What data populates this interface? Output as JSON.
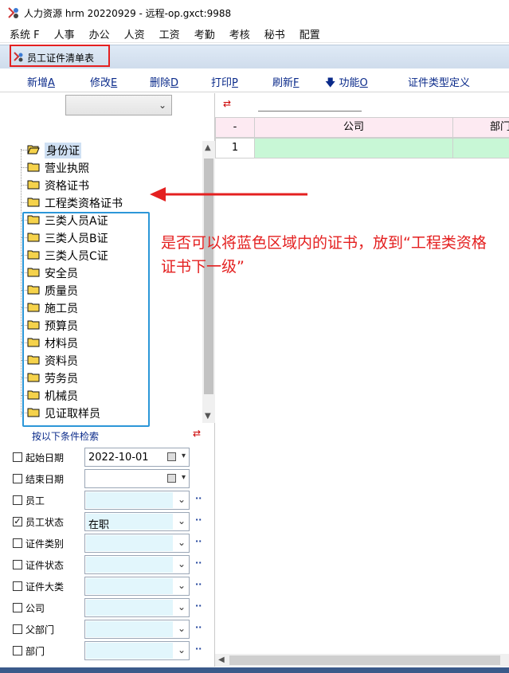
{
  "window": {
    "title": "人力资源 hrm 20220929 - 远程-op.gxct:9988"
  },
  "menu": [
    "系统 F",
    "人事",
    "办公",
    "人资",
    "工资",
    "考勤",
    "考核",
    "秘书",
    "配置"
  ],
  "child_window": {
    "title": "员工证件清单表"
  },
  "toolbar": {
    "new_label": "新增",
    "new_key": "A",
    "edit_label": "修改",
    "edit_key": "E",
    "delete_label": "删除",
    "delete_key": "D",
    "print_label": "打印",
    "print_key": "P",
    "refresh_label": "刷新",
    "refresh_key": "F",
    "func_label": "功能",
    "func_key": "O",
    "cert_type_label": "证件类型定义"
  },
  "tree": {
    "items": [
      "身份证",
      "营业执照",
      "资格证书",
      "工程类资格证书",
      "三类人员A证",
      "三类人员B证",
      "三类人员C证",
      "安全员",
      "质量员",
      "施工员",
      "预算员",
      "材料员",
      "资料员",
      "劳务员",
      "机械员",
      "见证取样员"
    ]
  },
  "search": {
    "header": "按以下条件检索",
    "fields": [
      {
        "label": "起始日期",
        "checked": false,
        "value": "2022-10-01",
        "type": "date"
      },
      {
        "label": "结束日期",
        "checked": false,
        "value": "",
        "type": "date"
      },
      {
        "label": "员工",
        "checked": false,
        "value": "",
        "type": "lookup"
      },
      {
        "label": "员工状态",
        "checked": true,
        "value": "在职",
        "type": "lookup"
      },
      {
        "label": "证件类别",
        "checked": false,
        "value": "",
        "type": "lookup"
      },
      {
        "label": "证件状态",
        "checked": false,
        "value": "",
        "type": "lookup"
      },
      {
        "label": "证件大类",
        "checked": false,
        "value": "",
        "type": "lookup"
      },
      {
        "label": "公司",
        "checked": false,
        "value": "",
        "type": "lookup"
      },
      {
        "label": "父部门",
        "checked": false,
        "value": "",
        "type": "lookup"
      },
      {
        "label": "部门",
        "checked": false,
        "value": "",
        "type": "lookup"
      }
    ]
  },
  "grid": {
    "columns": [
      "-",
      "公司",
      "部门"
    ],
    "rows": [
      [
        "1",
        "",
        ""
      ]
    ]
  },
  "annotation": {
    "text": "是否可以将蓝色区域内的证书，放到“工程类资格证书下一级”"
  }
}
